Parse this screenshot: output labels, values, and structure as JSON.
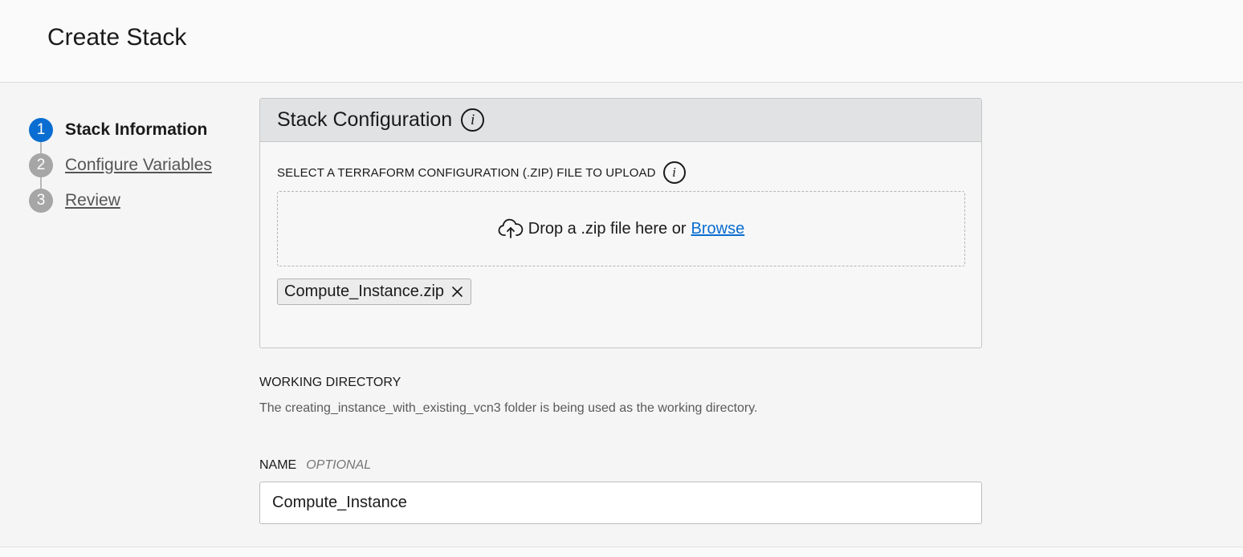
{
  "header": {
    "title": "Create Stack"
  },
  "steps": [
    {
      "number": "1",
      "label": "Stack Information",
      "active": true
    },
    {
      "number": "2",
      "label": "Configure Variables",
      "active": false
    },
    {
      "number": "3",
      "label": "Review",
      "active": false
    }
  ],
  "stack_config": {
    "title": "Stack Configuration",
    "info_icon": "info-icon",
    "upload_label": "SELECT A TERRAFORM CONFIGURATION (.ZIP) FILE TO UPLOAD",
    "dropzone_text": "Drop a .zip file here or",
    "browse_link": "Browse",
    "uploaded_file": "Compute_Instance.zip",
    "upload_icon": "cloud-upload-icon",
    "remove_icon": "close-icon"
  },
  "working_directory": {
    "label": "WORKING DIRECTORY",
    "description": "The creating_instance_with_existing_vcn3 folder is being used as the working directory."
  },
  "name_field": {
    "label": "NAME",
    "optional_tag": "OPTIONAL",
    "value": "Compute_Instance"
  },
  "colors": {
    "accent": "#0a6dd1",
    "step_inactive": "#a6a6a6",
    "panel_header": "#e0e2e4"
  }
}
